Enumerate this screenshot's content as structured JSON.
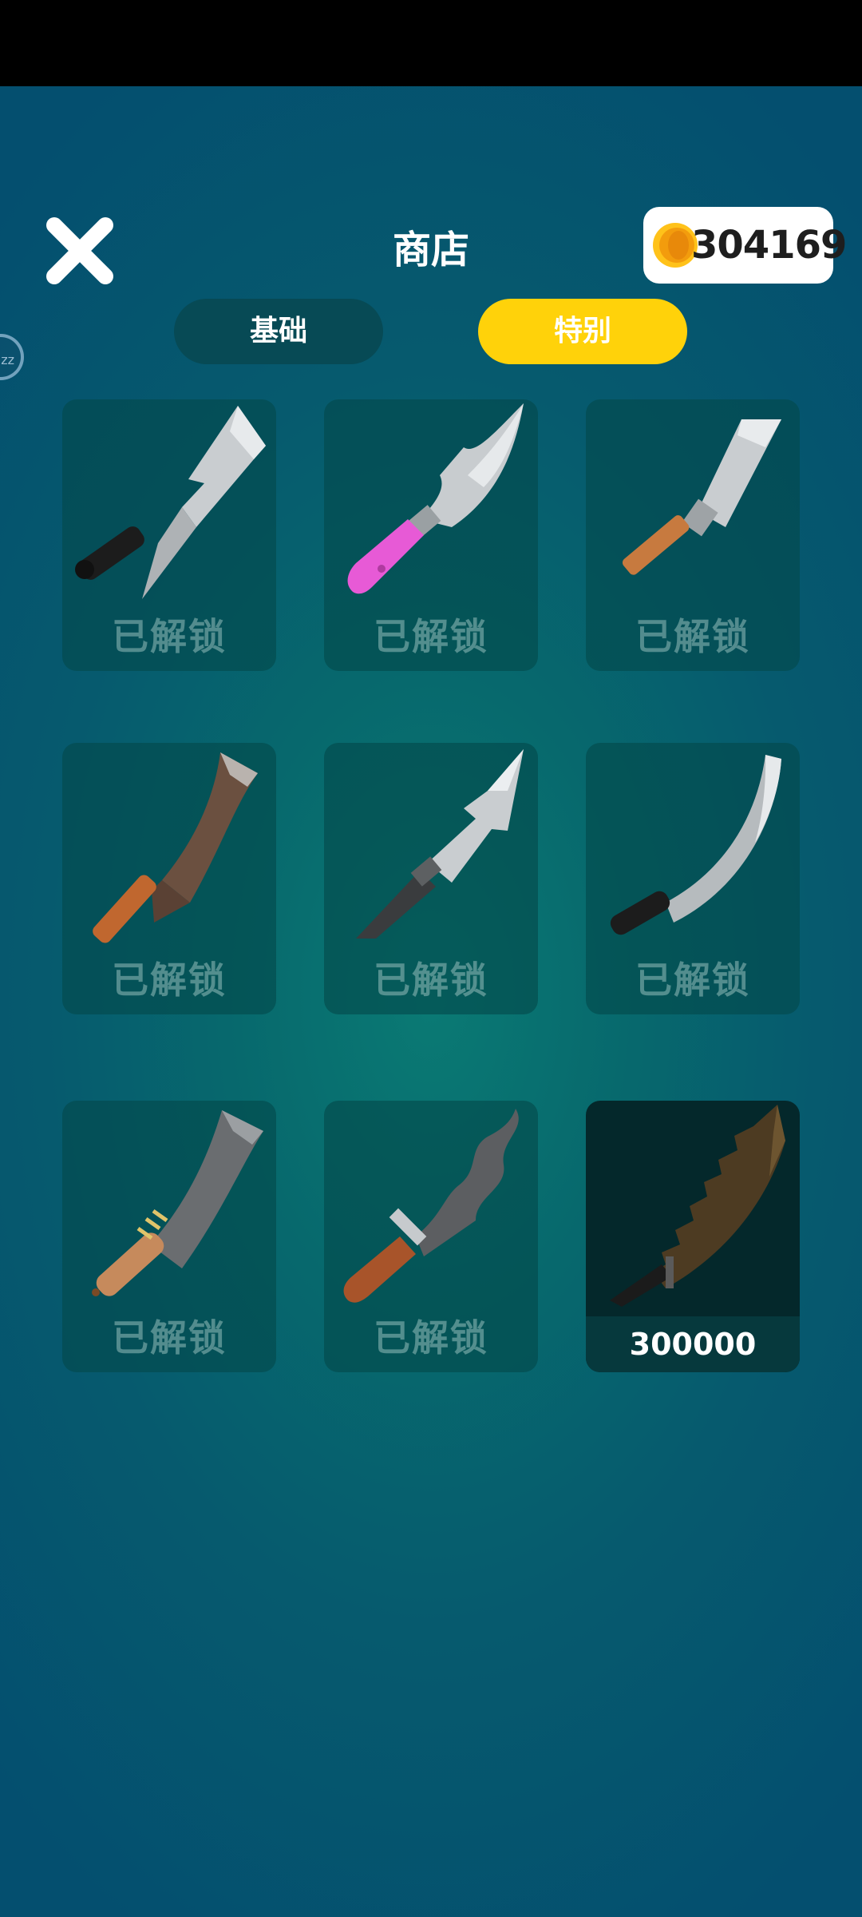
{
  "header": {
    "title": "商店",
    "coins": "304169"
  },
  "tabs": [
    {
      "label": "基础",
      "active": false
    },
    {
      "label": "特别",
      "active": true
    }
  ],
  "side_badge": "zz",
  "items": [
    {
      "status": "已解锁",
      "icon": "cleaver-knife-icon"
    },
    {
      "status": "已解锁",
      "icon": "pink-handle-knife-icon"
    },
    {
      "status": "已解锁",
      "icon": "chef-knife-icon"
    },
    {
      "status": "已解锁",
      "icon": "rusty-cleaver-icon"
    },
    {
      "status": "已解锁",
      "icon": "barbed-knife-icon"
    },
    {
      "status": "已解锁",
      "icon": "curved-blade-icon"
    },
    {
      "status": "已解锁",
      "icon": "wrapped-cleaver-icon"
    },
    {
      "status": "已解锁",
      "icon": "wavy-kris-icon"
    },
    {
      "status": "300000",
      "icon": "serrated-saw-blade-icon"
    }
  ],
  "colors": {
    "accent": "#ffd20a",
    "tab_inactive": "#074a55",
    "background": "#07696d"
  }
}
